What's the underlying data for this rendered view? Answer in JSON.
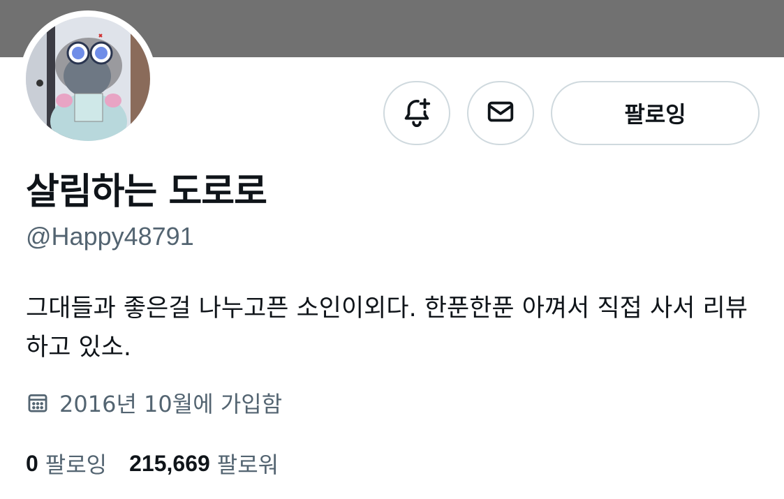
{
  "profile": {
    "display_name": "살림하는 도로로",
    "handle": "@Happy48791",
    "bio": "그대들과 좋은걸 나누고픈 소인이외다. 한푼한푼 아껴서 직접 사서 리뷰하고 있소.",
    "joined": "2016년 10월에 가입함",
    "avatar": "avatar"
  },
  "actions": {
    "notify_icon": "bell-plus-icon",
    "message_icon": "envelope-icon",
    "follow_label": "팔로잉"
  },
  "stats": {
    "following_count": "0",
    "following_label": "팔로잉",
    "followers_count": "215,669",
    "followers_label": "팔로워"
  },
  "colors": {
    "banner": "#717171",
    "text_primary": "#0f1419",
    "text_secondary": "#536471",
    "border": "#cfd9de"
  }
}
